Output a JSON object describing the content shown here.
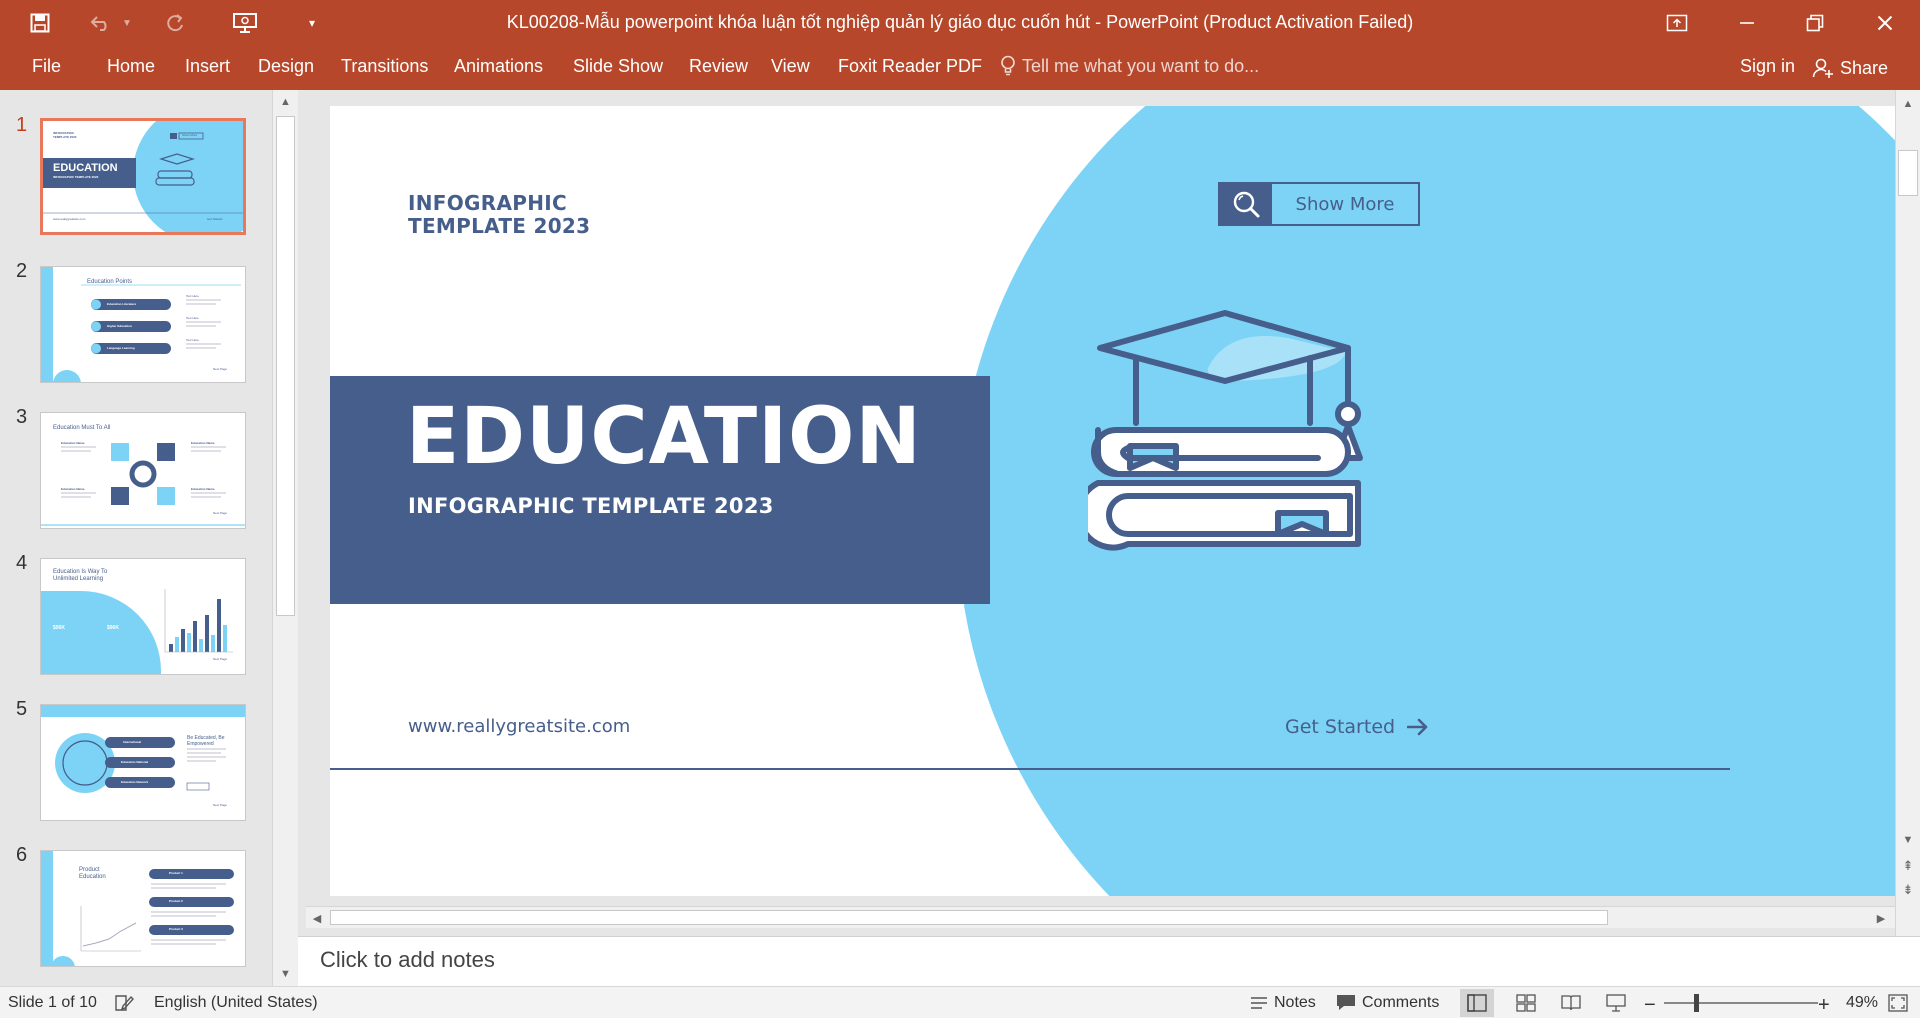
{
  "window": {
    "title": "KL00208-Mẫu powerpoint khóa luận tốt nghiệp quản lý giáo dục cuốn hút - PowerPoint (Product Activation Failed)"
  },
  "ribbon": {
    "tabs": [
      "File",
      "Home",
      "Insert",
      "Design",
      "Transitions",
      "Animations",
      "Slide Show",
      "Review",
      "View",
      "Foxit Reader PDF"
    ],
    "tell_me_placeholder": "Tell me what you want to do...",
    "sign_in": "Sign in",
    "share": "Share"
  },
  "thumbnails": {
    "numbers": [
      "1",
      "2",
      "3",
      "4",
      "5",
      "6"
    ],
    "slide1": {
      "kicker": "INFOGRAPHIC TEMPLATE 2023",
      "title": "EDUCATION",
      "subtitle": "INFOGRAPHIC TEMPLATE 2023",
      "button": "Show More",
      "url": "www.reallygreatsite.com",
      "cta": "Get Started"
    },
    "slide2": {
      "title": "Education Points",
      "pills": [
        "Education Literature",
        "Higher Education",
        "Language Learning"
      ],
      "labels": [
        "Text Here",
        "Text Here",
        "Text Here"
      ],
      "cta": "Next Page"
    },
    "slide3": {
      "title": "Education Must To All",
      "labels": [
        "Education Name",
        "Education Name",
        "Education Name",
        "Education Name"
      ],
      "cta": "Next Page"
    },
    "slide4": {
      "title": "Education Is Way To Unlimited Learning",
      "stat1": "$56K",
      "stat2": "$96K",
      "cta": "Next Page"
    },
    "slide5": {
      "pills": [
        "International",
        "Education National",
        "Education Network"
      ],
      "heading": "Be Educated, Be Empowered",
      "cta": "Next Page"
    },
    "slide6": {
      "title": "Product Education",
      "pills": [
        "Product 1",
        "Product 2",
        "Product 3"
      ]
    }
  },
  "slide": {
    "kicker": "INFOGRAPHIC\nTEMPLATE 2023",
    "title": "EDUCATION",
    "subtitle": "INFOGRAPHIC TEMPLATE 2023",
    "button": "Show More",
    "url": "www.reallygreatsite.com",
    "cta": "Get Started"
  },
  "notes_placeholder": "Click to add notes",
  "status": {
    "slide_counter": "Slide 1 of 10",
    "language": "English (United States)",
    "notes": "Notes",
    "comments": "Comments",
    "zoom": "49%"
  },
  "colors": {
    "accent": "#b7472a",
    "navy": "#465e8b",
    "sky": "#7dd3f5"
  }
}
